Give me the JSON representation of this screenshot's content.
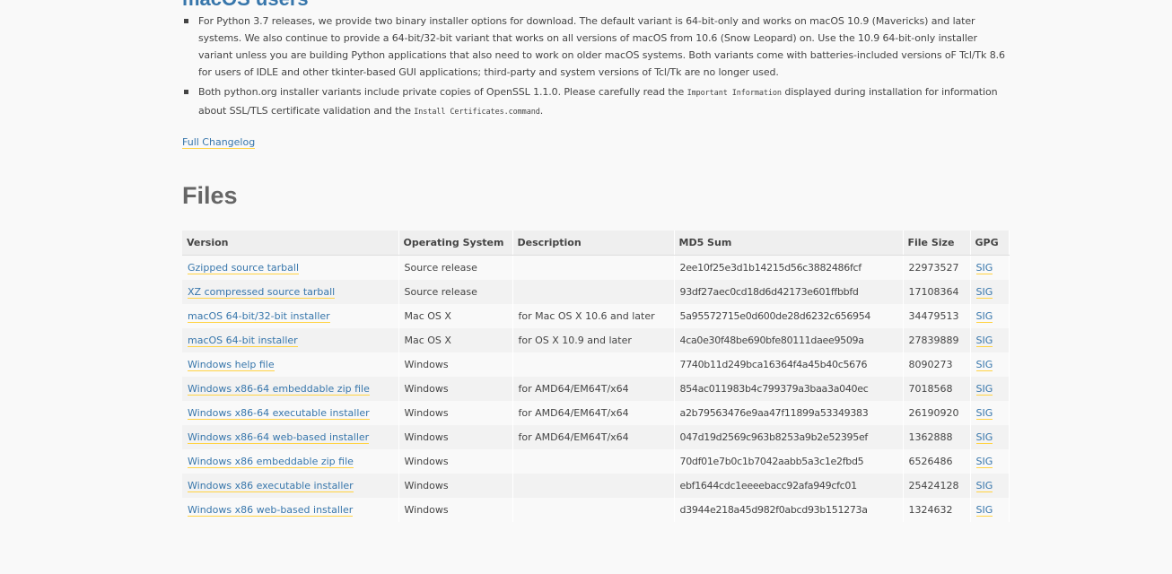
{
  "macos_section": {
    "heading": "macOS users",
    "notes": [
      {
        "text": "For Python 3.7 releases, we provide two binary installer options for download. The default variant is 64-bit-only and works on macOS 10.9 (Mavericks) and later systems. We also continue to provide a 64-bit/32-bit variant that works on all versions of macOS from 10.6 (Snow Leopard) on. Use the 10.9 64-bit-only installer variant unless you are building Python applications that also need to work on older macOS systems. Both variants come with batteries-included versions oF Tcl/Tk 8.6 for users of IDLE and other tkinter-based GUI applications; third-party and system versions of Tcl/Tk are no longer used."
      },
      {
        "text_before": "Both python.org installer variants include private copies of OpenSSL 1.1.0. Please carefully read the ",
        "code1": "Important Information",
        "text_middle": " displayed during installation for information about SSL/TLS certificate validation and the ",
        "code2": "Install Certificates.command",
        "text_after": "."
      }
    ]
  },
  "changelog_link": "Full Changelog",
  "files": {
    "heading": "Files",
    "columns": [
      "Version",
      "Operating System",
      "Description",
      "MD5 Sum",
      "File Size",
      "GPG"
    ],
    "rows": [
      {
        "version": "Gzipped source tarball",
        "os": "Source release",
        "description": "",
        "md5": "2ee10f25e3d1b14215d56c3882486fcf",
        "size": "22973527",
        "gpg": "SIG"
      },
      {
        "version": "XZ compressed source tarball",
        "os": "Source release",
        "description": "",
        "md5": "93df27aec0cd18d6d42173e601ffbbfd",
        "size": "17108364",
        "gpg": "SIG"
      },
      {
        "version": "macOS 64-bit/32-bit installer",
        "os": "Mac OS X",
        "description": "for Mac OS X 10.6 and later",
        "md5": "5a95572715e0d600de28d6232c656954",
        "size": "34479513",
        "gpg": "SIG"
      },
      {
        "version": "macOS 64-bit installer",
        "os": "Mac OS X",
        "description": "for OS X 10.9 and later",
        "md5": "4ca0e30f48be690bfe80111daee9509a",
        "size": "27839889",
        "gpg": "SIG"
      },
      {
        "version": "Windows help file",
        "os": "Windows",
        "description": "",
        "md5": "7740b11d249bca16364f4a45b40c5676",
        "size": "8090273",
        "gpg": "SIG"
      },
      {
        "version": "Windows x86-64 embeddable zip file",
        "os": "Windows",
        "description": "for AMD64/EM64T/x64",
        "md5": "854ac011983b4c799379a3baa3a040ec",
        "size": "7018568",
        "gpg": "SIG"
      },
      {
        "version": "Windows x86-64 executable installer",
        "os": "Windows",
        "description": "for AMD64/EM64T/x64",
        "md5": "a2b79563476e9aa47f11899a53349383",
        "size": "26190920",
        "gpg": "SIG"
      },
      {
        "version": "Windows x86-64 web-based installer",
        "os": "Windows",
        "description": "for AMD64/EM64T/x64",
        "md5": "047d19d2569c963b8253a9b2e52395ef",
        "size": "1362888",
        "gpg": "SIG"
      },
      {
        "version": "Windows x86 embeddable zip file",
        "os": "Windows",
        "description": "",
        "md5": "70df01e7b0c1b7042aabb5a3c1e2fbd5",
        "size": "6526486",
        "gpg": "SIG"
      },
      {
        "version": "Windows x86 executable installer",
        "os": "Windows",
        "description": "",
        "md5": "ebf1644cdc1eeeebacc92afa949cfc01",
        "size": "25424128",
        "gpg": "SIG"
      },
      {
        "version": "Windows x86 web-based installer",
        "os": "Windows",
        "description": "",
        "md5": "d3944e218a45d982f0abcd93b151273a",
        "size": "1324632",
        "gpg": "SIG"
      }
    ]
  },
  "colors": {
    "link": "#3776ab",
    "link_underline": "#ffd343",
    "heading_gray": "#666666",
    "text": "#444444",
    "background": "#f9f9f9"
  }
}
